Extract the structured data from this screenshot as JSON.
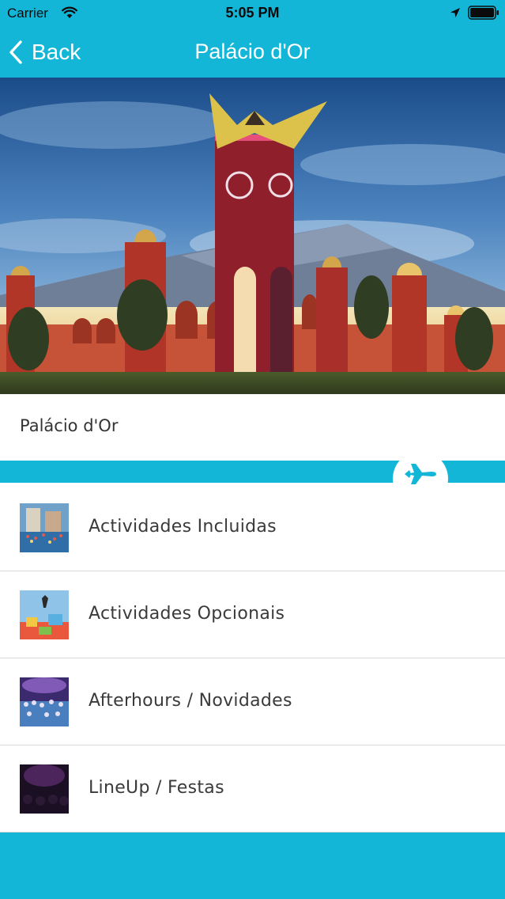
{
  "status_bar": {
    "carrier": "Carrier",
    "time": "5:05 PM"
  },
  "nav": {
    "back_label": "Back",
    "title": "Palácio d'Or"
  },
  "venue": {
    "title": "Palácio d'Or"
  },
  "menu": {
    "items": [
      {
        "label": "Actividades Incluidas",
        "thumb": "pool-party-thumbnail"
      },
      {
        "label": "Actividades Opcionais",
        "thumb": "inflatable-park-thumbnail"
      },
      {
        "label": "Afterhours / Novidades",
        "thumb": "concert-crowd-thumbnail"
      },
      {
        "label": "LineUp / Festas",
        "thumb": "dark-club-thumbnail"
      }
    ]
  },
  "colors": {
    "accent": "#14b6d8",
    "divider": "#d8d8d8",
    "text": "#333333"
  },
  "icons": {
    "wifi": "wifi-icon",
    "location": "location-arrow-icon",
    "battery": "battery-icon",
    "back": "chevron-left-icon",
    "plane": "airplane-icon"
  }
}
